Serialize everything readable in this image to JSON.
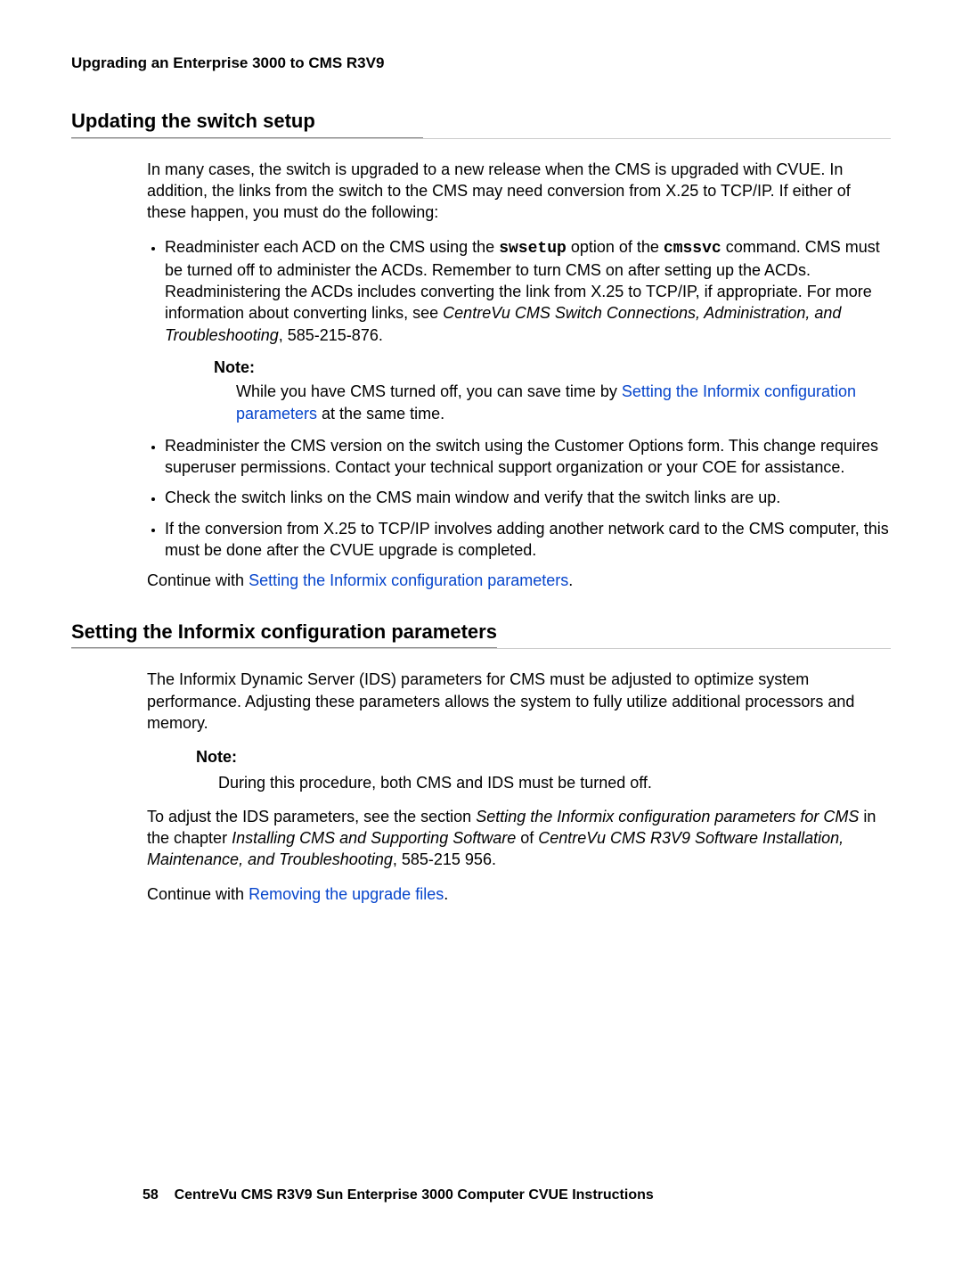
{
  "header": "Upgrading an Enterprise 3000 to CMS R3V9",
  "section1": {
    "heading": "Updating the switch setup",
    "intro": "In many cases, the switch is upgraded to a new release when the CMS is upgraded with CVUE. In addition, the links from the switch to the CMS may need conversion from X.25 to TCP/IP. If either of these happen, you must do the following:",
    "bullet1_pre": "Readminister each ACD on the CMS using the ",
    "bullet1_code1": "swsetup",
    "bullet1_mid": " option of the ",
    "bullet1_code2": "cmssvc",
    "bullet1_post": " command. CMS must be turned off to administer the ACDs. Remember to turn CMS on after setting up the ACDs. Readministering the ACDs includes converting the link from X.25 to TCP/IP, if appropriate. For more information about converting links, see ",
    "bullet1_italic": "CentreVu CMS Switch Connections, Administration, and Troubleshooting",
    "bullet1_tail": ", 585-215-876.",
    "note_label": "Note:",
    "note_pre": "While you have CMS turned off, you can save time by ",
    "note_link": "Setting the Informix configuration parameters",
    "note_post": " at the same time.",
    "bullet2": "Readminister the CMS version on the switch using the Customer Options form. This change requires superuser permissions. Contact your technical support organization or your COE for assistance.",
    "bullet3": "Check the switch links on the CMS main window and verify that the switch links are up.",
    "bullet4": "If the conversion from X.25 to TCP/IP involves adding another network card to the CMS computer, this must be done after the CVUE upgrade is completed.",
    "continue_pre": "Continue with ",
    "continue_link": "Setting the Informix configuration parameters",
    "continue_post": "."
  },
  "section2": {
    "heading": "Setting the Informix configuration parameters",
    "intro": "The Informix Dynamic Server (IDS) parameters for CMS must be adjusted to optimize system performance. Adjusting these parameters allows the system to fully utilize additional processors and memory.",
    "note_label": "Note:",
    "note_text": "During this procedure, both CMS and IDS must be turned off.",
    "para_pre": "To adjust the IDS parameters, see the section ",
    "para_it1": "Setting the Informix configuration parameters for CMS",
    "para_mid1": " in the chapter ",
    "para_it2": "Installing CMS and Supporting Software",
    "para_mid2": " of ",
    "para_it3": "CentreVu CMS R3V9 Software Installation, Maintenance, and Troubleshooting",
    "para_tail": ", 585-215 956.",
    "continue_pre": "Continue with ",
    "continue_link": "Removing the upgrade files",
    "continue_post": "."
  },
  "footer": {
    "page": "58",
    "title": "CentreVu CMS R3V9 Sun Enterprise 3000 Computer CVUE Instructions"
  }
}
